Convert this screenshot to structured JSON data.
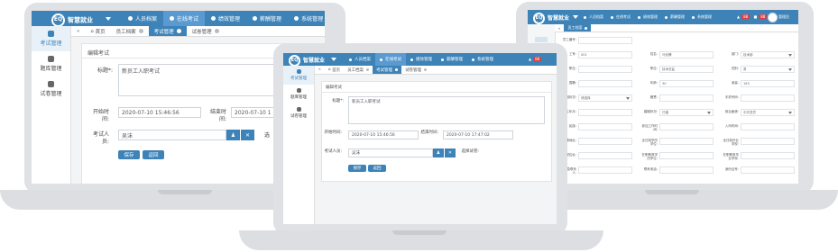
{
  "app": {
    "logo_text": "智慧就业",
    "logo_mark": "EQ"
  },
  "nav": [
    {
      "label": "人员档案",
      "icon": "user-icon"
    },
    {
      "label": "在线考试",
      "icon": "exam-icon"
    },
    {
      "label": "绩效管理",
      "icon": "performance-icon"
    },
    {
      "label": "薪酬管理",
      "icon": "salary-icon"
    },
    {
      "label": "系统管理",
      "icon": "settings-icon"
    }
  ],
  "sidebar": [
    {
      "label": "考试管理",
      "icon": "gear-icon"
    },
    {
      "label": "题库管理",
      "icon": "gear-icon"
    },
    {
      "label": "试卷管理",
      "icon": "gear-icon"
    }
  ],
  "tabs": {
    "home": "首页",
    "items": [
      "员工档案",
      "考试管理",
      "试卷管理"
    ]
  },
  "edit": {
    "panel_title": "编辑考试",
    "title_label": "标题*:",
    "title_value": "新员工入职考试",
    "start_label": "开始时间:",
    "start_value": "2020-07-10 15:46:56",
    "end_label": "结束时间:",
    "end_value_left": "2020-07-10 1",
    "end_value_center": "2020-07-10 17:47:02",
    "examinee_label": "考试人员:",
    "examinee_value": "吴沫",
    "paper_label_left": "选",
    "paper_label_center": "选择试卷:",
    "save_label": "保存",
    "back_label": "返回"
  },
  "right": {
    "tab": "员工档案",
    "badge": "88",
    "badge2": "88",
    "username": "管理员",
    "rows": [
      [
        {
          "l": "员工编号:",
          "v": ""
        }
      ],
      [
        {
          "l": "工号:",
          "v": "001"
        },
        {
          "l": "姓名:",
          "v": "马化腾"
        },
        {
          "l": "部门:",
          "v": "技术部"
        }
      ],
      [
        {
          "l": "职位:",
          "v": ""
        },
        {
          "l": "职位:",
          "v": "技术总监"
        },
        {
          "l": "性别:",
          "v": "男"
        }
      ],
      [
        {
          "l": "国籍:",
          "v": ""
        },
        {
          "l": "年龄:",
          "v": "30"
        },
        {
          "l": "身高:",
          "v": "163"
        }
      ],
      [
        {
          "l": "婚姻状况:",
          "v": "请选择"
        },
        {
          "l": "籍贯:",
          "v": ""
        },
        {
          "l": "手机号码:",
          "v": ""
        }
      ],
      [
        {
          "l": "出生年月:",
          "v": ""
        },
        {
          "l": "婚姻状况:",
          "v": "已婚"
        },
        {
          "l": "政治面貌:",
          "v": "中共党员"
        }
      ],
      [
        {
          "l": "民族:",
          "v": ""
        },
        {
          "l": "参加工作时间:",
          "v": ""
        },
        {
          "l": "入司时间:",
          "v": ""
        }
      ],
      [
        {
          "l": "户籍地址:",
          "v": ""
        },
        {
          "l": "全日制学历学位:",
          "v": ""
        },
        {
          "l": "全日制毕业学校:",
          "v": ""
        }
      ],
      [
        {
          "l": "现住址:",
          "v": ""
        },
        {
          "l": "在职教育学历学位:",
          "v": ""
        },
        {
          "l": "在职教育毕业学校:",
          "v": ""
        }
      ],
      [
        {
          "l": "紧急联系人:",
          "v": ""
        },
        {
          "l": "联系电话:",
          "v": ""
        },
        {
          "l": "身份证号:",
          "v": ""
        }
      ]
    ]
  },
  "colors": {
    "primary": "#3d83b8",
    "nav_active": "#5a9ad0",
    "badge": "#e23c3c"
  }
}
